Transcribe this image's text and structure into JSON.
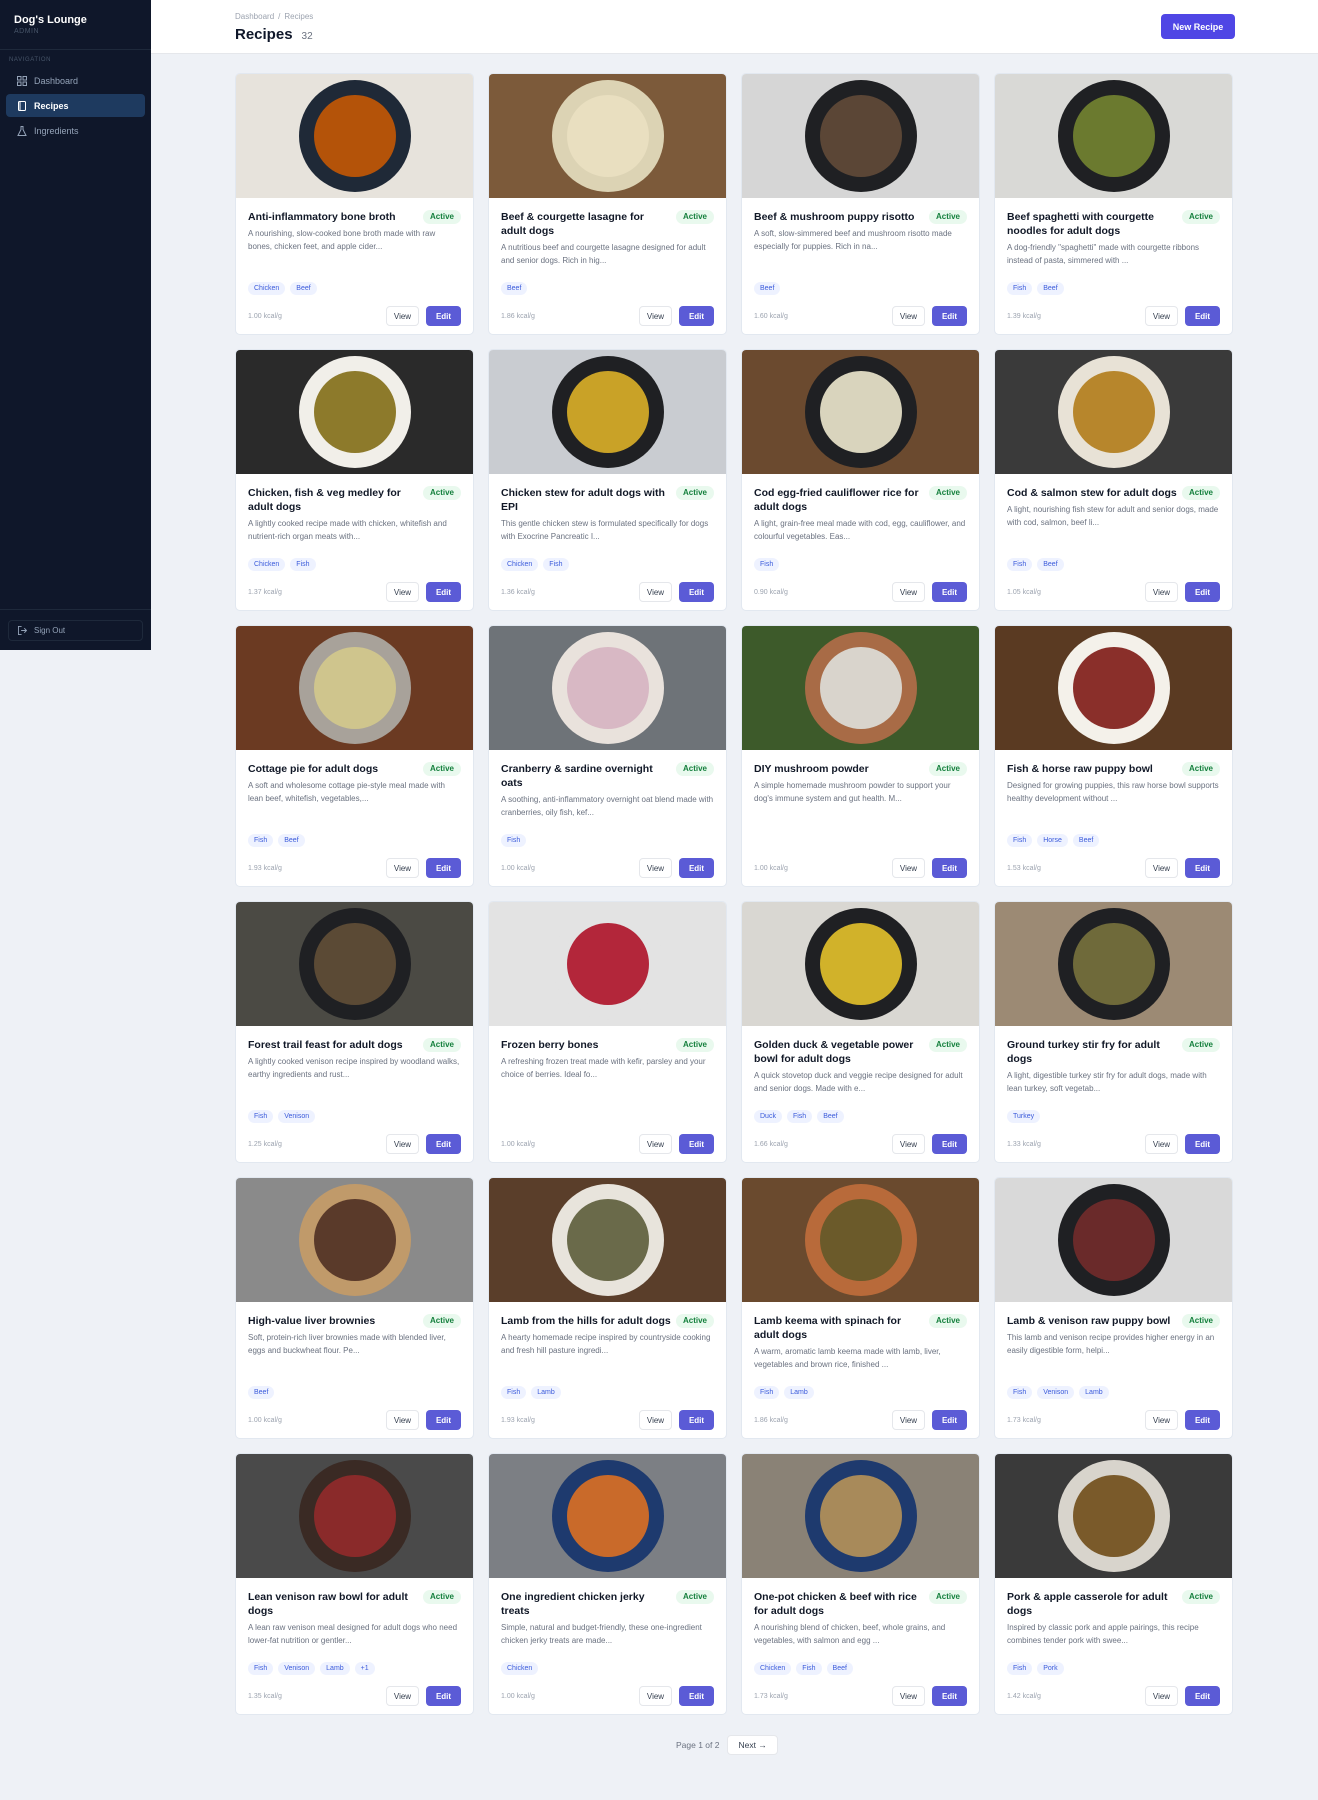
{
  "app": {
    "name": "Dog's Lounge",
    "role": "ADMIN"
  },
  "nav": {
    "heading": "NAVIGATION",
    "items": [
      {
        "label": "Dashboard",
        "icon": "grid-icon",
        "active": false
      },
      {
        "label": "Recipes",
        "icon": "book-icon",
        "active": true
      },
      {
        "label": "Ingredients",
        "icon": "flask-icon",
        "active": false
      }
    ],
    "sign_out": "Sign Out"
  },
  "breadcrumb": [
    "Dashboard",
    "Recipes"
  ],
  "page": {
    "title": "Recipes",
    "count": "32",
    "new_button": "New Recipe"
  },
  "colors": {
    "accent": "#4f46e5",
    "sidebar": "#0f172a",
    "active_green": "#15803d"
  },
  "card_actions": {
    "view": "View",
    "edit": "Edit"
  },
  "recipes": [
    {
      "title": "Anti-inflammatory bone broth",
      "status": "Active",
      "desc": "A nourishing, slow-cooked bone broth made with raw bones, chicken feet, and apple cider...",
      "tags": [
        "Chicken",
        "Beef"
      ],
      "kcal": "1.00 kcal/g",
      "img": [
        "#e7e3dc",
        "#1f2937",
        "#b45309"
      ]
    },
    {
      "title": "Beef & courgette lasagne for adult dogs",
      "status": "Active",
      "desc": "A nutritious beef and courgette lasagne designed for adult and senior dogs. Rich in hig...",
      "tags": [
        "Beef"
      ],
      "kcal": "1.86 kcal/g",
      "img": [
        "#7c5a3a",
        "#dcd3b4",
        "#e9dfc0"
      ]
    },
    {
      "title": "Beef & mushroom puppy risotto",
      "status": "Active",
      "desc": "A soft, slow-simmered beef and mushroom risotto made especially for puppies. Rich in na...",
      "tags": [
        "Beef"
      ],
      "kcal": "1.60 kcal/g",
      "img": [
        "#d6d6d6",
        "#1f2023",
        "#5b4636"
      ]
    },
    {
      "title": "Beef spaghetti with courgette noodles for adult dogs",
      "status": "Active",
      "desc": "A dog-friendly \"spaghetti\" made with courgette ribbons instead of pasta, simmered with ...",
      "tags": [
        "Fish",
        "Beef"
      ],
      "kcal": "1.39 kcal/g",
      "img": [
        "#d9d9d6",
        "#1f2023",
        "#6b7a2f"
      ]
    },
    {
      "title": "Chicken, fish & veg medley for adult dogs",
      "status": "Active",
      "desc": "A lightly cooked recipe made with chicken, whitefish and nutrient-rich organ meats with...",
      "tags": [
        "Chicken",
        "Fish"
      ],
      "kcal": "1.37 kcal/g",
      "img": [
        "#2a2a2a",
        "#f1efe9",
        "#8d7a2b"
      ]
    },
    {
      "title": "Chicken stew for adult dogs with EPI",
      "status": "Active",
      "desc": "This gentle chicken stew is formulated specifically for dogs with Exocrine Pancreatic I...",
      "tags": [
        "Chicken",
        "Fish"
      ],
      "kcal": "1.36 kcal/g",
      "img": [
        "#c9ccd1",
        "#1f2023",
        "#c9a227"
      ]
    },
    {
      "title": "Cod egg-fried cauliflower rice for adult dogs",
      "status": "Active",
      "desc": "A light, grain-free meal made with cod, egg, cauliflower, and colourful vegetables. Eas...",
      "tags": [
        "Fish"
      ],
      "kcal": "0.90 kcal/g",
      "img": [
        "#6b4a2f",
        "#1f2023",
        "#d9d4bd"
      ]
    },
    {
      "title": "Cod & salmon stew for adult dogs",
      "status": "Active",
      "desc": "A light, nourishing fish stew for adult and senior dogs, made with cod, salmon, beef li...",
      "tags": [
        "Fish",
        "Beef"
      ],
      "kcal": "1.05 kcal/g",
      "img": [
        "#3a3a3a",
        "#e8e2d6",
        "#b7862c"
      ]
    },
    {
      "title": "Cottage pie for adult dogs",
      "status": "Active",
      "desc": "A soft and wholesome cottage pie-style meal made with lean beef, whitefish, vegetables,...",
      "tags": [
        "Fish",
        "Beef"
      ],
      "kcal": "1.93 kcal/g",
      "img": [
        "#6b3a22",
        "#a8a29a",
        "#cfc58d"
      ]
    },
    {
      "title": "Cranberry & sardine overnight oats",
      "status": "Active",
      "desc": "A soothing, anti-inflammatory overnight oat blend made with cranberries, oily fish, kef...",
      "tags": [
        "Fish"
      ],
      "kcal": "1.00 kcal/g",
      "img": [
        "#6e7378",
        "#e9e2dc",
        "#d8b8c4"
      ]
    },
    {
      "title": "DIY mushroom powder",
      "status": "Active",
      "desc": "A simple homemade mushroom powder to support your dog's immune system and gut health. M...",
      "tags": [],
      "kcal": "1.00 kcal/g",
      "img": [
        "#3d5a2a",
        "#a86b46",
        "#d9d4cc"
      ]
    },
    {
      "title": "Fish & horse raw puppy bowl",
      "status": "Active",
      "desc": "Designed for growing puppies, this raw horse bowl supports healthy development without ...",
      "tags": [
        "Fish",
        "Horse",
        "Beef"
      ],
      "kcal": "1.53 kcal/g",
      "img": [
        "#5a3a22",
        "#f4f1ea",
        "#8a2f2a"
      ]
    },
    {
      "title": "Forest trail feast for adult dogs",
      "status": "Active",
      "desc": "A lightly cooked venison recipe inspired by woodland walks, earthy ingredients and rust...",
      "tags": [
        "Fish",
        "Venison"
      ],
      "kcal": "1.25 kcal/g",
      "img": [
        "#4b4a44",
        "#1f2023",
        "#5b4a35"
      ]
    },
    {
      "title": "Frozen berry bones",
      "status": "Active",
      "desc": "A refreshing frozen treat made with kefir, parsley and your choice of berries. Ideal fo...",
      "tags": [],
      "kcal": "1.00 kcal/g",
      "img": [
        "#e3e3e3",
        "#e3e3e3",
        "#b3263a"
      ]
    },
    {
      "title": "Golden duck & vegetable power bowl for adult dogs",
      "status": "Active",
      "desc": "A quick stovetop duck and veggie recipe designed for adult and senior dogs. Made with e...",
      "tags": [
        "Duck",
        "Fish",
        "Beef"
      ],
      "kcal": "1.66 kcal/g",
      "img": [
        "#d9d7d2",
        "#1f2023",
        "#d1b22a"
      ]
    },
    {
      "title": "Ground turkey stir fry for adult dogs",
      "status": "Active",
      "desc": "A light, digestible turkey stir fry for adult dogs, made with lean turkey, soft vegetab...",
      "tags": [
        "Turkey"
      ],
      "kcal": "1.33 kcal/g",
      "img": [
        "#9c8a74",
        "#1f2023",
        "#6f6a3a"
      ]
    },
    {
      "title": "High-value liver brownies",
      "status": "Active",
      "desc": "Soft, protein-rich liver brownies made with blended liver, eggs and buckwheat flour. Pe...",
      "tags": [
        "Beef"
      ],
      "kcal": "1.00 kcal/g",
      "img": [
        "#8a8a8a",
        "#c09a6a",
        "#5a3a2a"
      ]
    },
    {
      "title": "Lamb from the hills for adult dogs",
      "status": "Active",
      "desc": "A hearty homemade recipe inspired by countryside cooking and fresh hill pasture ingredi...",
      "tags": [
        "Fish",
        "Lamb"
      ],
      "kcal": "1.93 kcal/g",
      "img": [
        "#5a3e2a",
        "#e8e4dc",
        "#6a6a4a"
      ]
    },
    {
      "title": "Lamb keema with spinach for adult dogs",
      "status": "Active",
      "desc": "A warm, aromatic lamb keema made with lamb, liver, vegetables and brown rice, finished ...",
      "tags": [
        "Fish",
        "Lamb"
      ],
      "kcal": "1.86 kcal/g",
      "img": [
        "#6a4a2e",
        "#b86a3a",
        "#6b5a2a"
      ]
    },
    {
      "title": "Lamb & venison raw puppy bowl",
      "status": "Active",
      "desc": "This lamb and venison recipe provides higher energy in an easily digestible form, helpi...",
      "tags": [
        "Fish",
        "Venison",
        "Lamb"
      ],
      "kcal": "1.73 kcal/g",
      "img": [
        "#d9d9d9",
        "#1f2023",
        "#6a2a2a"
      ]
    },
    {
      "title": "Lean venison raw bowl for adult dogs",
      "status": "Active",
      "desc": "A lean raw venison meal designed for adult dogs who need lower-fat nutrition or gentler...",
      "tags": [
        "Fish",
        "Venison",
        "Lamb",
        "+1"
      ],
      "kcal": "1.35 kcal/g",
      "img": [
        "#4a4a4a",
        "#3a2a24",
        "#8a2a2a"
      ]
    },
    {
      "title": "One ingredient chicken jerky treats",
      "status": "Active",
      "desc": "Simple, natural and budget-friendly, these one-ingredient chicken jerky treats are made...",
      "tags": [
        "Chicken"
      ],
      "kcal": "1.00 kcal/g",
      "img": [
        "#7c7f84",
        "#1e3a6e",
        "#c96a2a"
      ]
    },
    {
      "title": "One-pot chicken & beef with rice for adult dogs",
      "status": "Active",
      "desc": "A nourishing blend of chicken, beef, whole grains, and vegetables, with salmon and egg ...",
      "tags": [
        "Chicken",
        "Fish",
        "Beef"
      ],
      "kcal": "1.73 kcal/g",
      "img": [
        "#8a8276",
        "#1e3a6e",
        "#a88a5a"
      ]
    },
    {
      "title": "Pork & apple casserole for adult dogs",
      "status": "Active",
      "desc": "Inspired by classic pork and apple pairings, this recipe combines tender pork with swee...",
      "tags": [
        "Fish",
        "Pork"
      ],
      "kcal": "1.42 kcal/g",
      "img": [
        "#3a3a3a",
        "#d8d4cc",
        "#7a5a2a"
      ]
    }
  ],
  "pagination": {
    "info": "Page 1 of 2",
    "next": "Next →"
  }
}
